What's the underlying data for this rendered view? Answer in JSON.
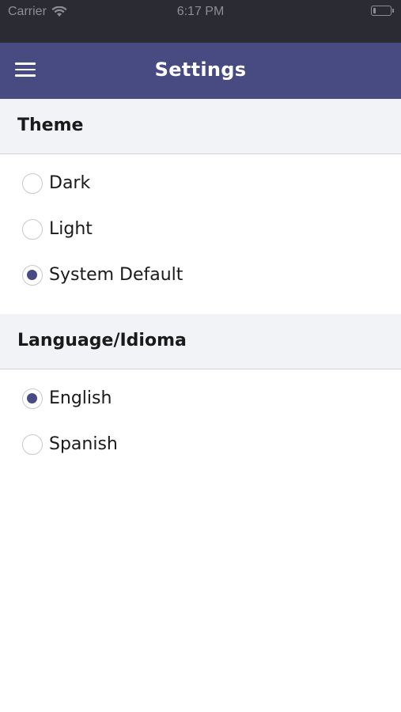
{
  "status_bar": {
    "carrier": "Carrier",
    "time": "6:17 PM",
    "wifi_icon": "wifi-icon",
    "battery_icon": "battery-icon",
    "battery_level": 0.15
  },
  "nav": {
    "title": "Settings",
    "menu_icon": "hamburger-menu-icon",
    "background": "#474b82"
  },
  "theme": {
    "title": "Theme",
    "options": [
      {
        "label": "Dark",
        "selected": false
      },
      {
        "label": "Light",
        "selected": false
      },
      {
        "label": "System Default",
        "selected": true
      }
    ]
  },
  "language": {
    "title": "Language/Idioma",
    "options": [
      {
        "label": "English",
        "selected": true
      },
      {
        "label": "Spanish",
        "selected": false
      }
    ]
  },
  "colors": {
    "accent": "#474b82",
    "section_background": "#f2f3f7",
    "status_bar": "#2b2b33"
  }
}
